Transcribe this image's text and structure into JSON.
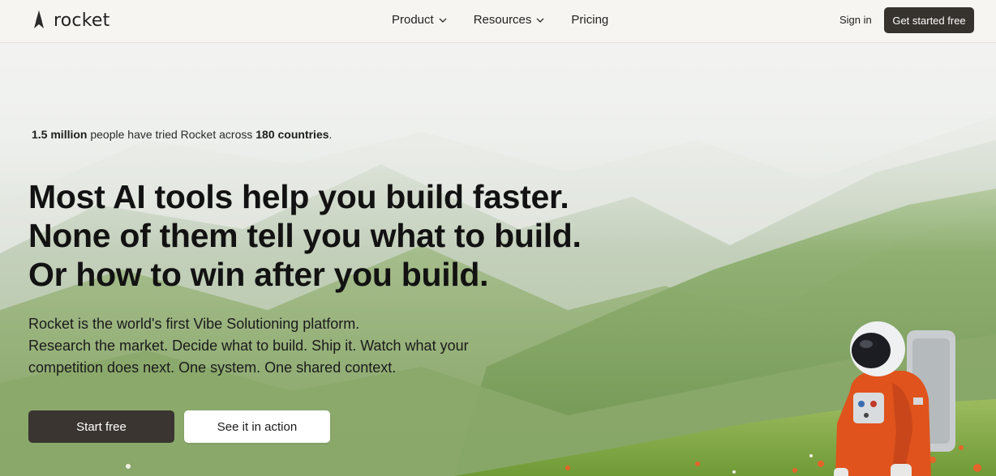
{
  "brand": {
    "name": "rocket",
    "logo_icon": "rocket-logo-icon"
  },
  "nav": {
    "links": [
      {
        "label": "Product",
        "has_dropdown": true
      },
      {
        "label": "Resources",
        "has_dropdown": true
      },
      {
        "label": "Pricing",
        "has_dropdown": false
      }
    ],
    "sign_in": "Sign in",
    "cta": "Get started free"
  },
  "hero": {
    "stat": {
      "count": "1.5 million",
      "middle": " people have tried Rocket across ",
      "countries": "180 countries",
      "end": "."
    },
    "headline": [
      "Most AI tools help you build faster.",
      "None of them tell you what to build.",
      "Or how to win after you build."
    ],
    "subtext": [
      "Rocket is the world's first Vibe Solutioning platform.",
      "Research the market. Decide what to build. Ship it. Watch what your",
      "competition does next. One system. One shared context."
    ],
    "primary_button": "Start free",
    "secondary_button": "See it in action"
  },
  "colors": {
    "dark_button": "#3a3530",
    "nav_background": "#f6f5f1",
    "hill_green": "#8fae6e",
    "suit_orange": "#e0531c"
  }
}
